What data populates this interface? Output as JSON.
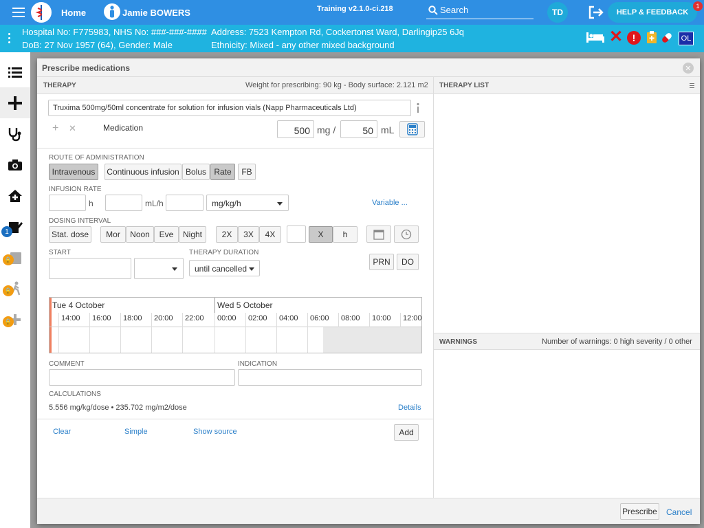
{
  "topbar": {
    "home_label": "Home",
    "user_name": "Jamie BOWERS",
    "version": "Training v2.1.0-ci.218",
    "search_placeholder": "Search",
    "user_initials": "TD",
    "help_label": "HELP & FEEDBACK",
    "help_badge": "1"
  },
  "patient": {
    "line1": "Hospital No: F775983, NHS No: ###-###-####",
    "line2": "DoB: 27 Nov 1957 (64), Gender: Male",
    "address": "Address: 7523 Kempton Rd, Cockertonst Ward, Darlingip25 6Jq",
    "ethnicity": "Ethnicity: Mixed - any other mixed background",
    "ol_badge": "OL"
  },
  "leftnav": {
    "badge_count": "1"
  },
  "modal": {
    "title": "Prescribe medications",
    "therapy_header": "THERAPY",
    "weight_info": "Weight for prescribing: 90 kg - Body surface: 2.121 m2",
    "therapy_list_header": "THERAPY LIST",
    "medication_value": "Truxima 500mg/50ml concentrate for solution for infusion vials (Napp Pharmaceuticals Ltd)",
    "medication_label": "Medication",
    "dose_value": "500",
    "dose_unit": "mg /",
    "volume_value": "50",
    "volume_unit": "mL",
    "route_label": "ROUTE OF ADMINISTRATION",
    "route_intravenous": "Intravenous",
    "route_continuous": "Continuous infusion",
    "route_bolus": "Bolus",
    "route_rate": "Rate",
    "route_fb": "FB",
    "infusion_label": "INFUSION RATE",
    "infusion_h": "h",
    "infusion_mlh": "mL/h",
    "infusion_unit_select": "mg/kg/h",
    "variable_link": "Variable ...",
    "dosing_label": "DOSING INTERVAL",
    "stat_dose": "Stat. dose",
    "mor": "Mor",
    "noon": "Noon",
    "eve": "Eve",
    "night": "Night",
    "x2": "2X",
    "x3": "3X",
    "x4": "4X",
    "x_label": "X",
    "h_label": "h",
    "start_label": "START",
    "duration_label": "THERAPY DURATION",
    "duration_value": "until cancelled",
    "prn": "PRN",
    "do": "DO",
    "timeline": {
      "day1": "Tue 4 October",
      "day2": "Wed 5 October",
      "times": [
        "14:00",
        "16:00",
        "18:00",
        "20:00",
        "22:00",
        "00:00",
        "02:00",
        "04:00",
        "06:00",
        "08:00",
        "10:00",
        "12:00"
      ]
    },
    "comment_label": "COMMENT",
    "indication_label": "INDICATION",
    "calculations_label": "CALCULATIONS",
    "calc_value": "5.556 mg/kg/dose • 235.702 mg/m2/dose",
    "details_link": "Details",
    "clear_link": "Clear",
    "simple_link": "Simple",
    "show_source_link": "Show source",
    "add_button": "Add",
    "warnings_header": "WARNINGS",
    "warnings_info": "Number of warnings: 0 high severity / 0 other",
    "prescribe_button": "Prescribe",
    "cancel_link": "Cancel"
  },
  "colors": {
    "topbar": "#2f8fe3",
    "patient_bar": "#1fb3e0",
    "link": "#2a7fc9",
    "alert_red": "#e0161b"
  }
}
